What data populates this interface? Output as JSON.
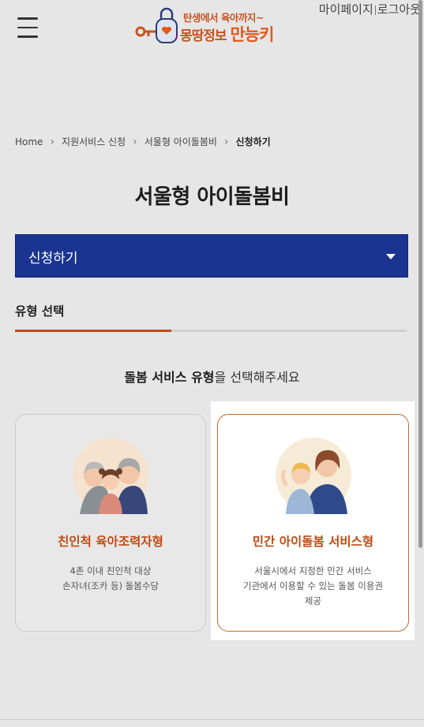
{
  "header": {
    "logo_top": "탄생에서 육아까지~",
    "logo_bottom_prefix": "몽땅정보 ",
    "logo_bottom_emphasis": "만능키",
    "mypage": "마이페이지",
    "logout": "로그아웃"
  },
  "breadcrumb": [
    "Home",
    "지원서비스 신청",
    "서울형 아이돌봄비",
    "신청하기"
  ],
  "page_title": "서울형 아이돌봄비",
  "select": {
    "selected": "신청하기"
  },
  "step": {
    "label": "유형 선택",
    "progress": 0.4
  },
  "prompt": {
    "emphasis": "돌봄 서비스 유형",
    "rest": "을 선택해주세요"
  },
  "cards": [
    {
      "title": "친인척 육아조력자형",
      "desc": [
        "4촌 이내 친인척 대상",
        "손자녀(조카 등) 돌봄수당"
      ],
      "icon": "grandparents-child-illustration"
    },
    {
      "title": "민간 아이돌봄 서비스형",
      "desc": [
        "서울시에서 지정한 민간 서비스",
        "기관에서 이용할 수 있는 돌봄 이용권",
        "제공"
      ],
      "icon": "mother-child-illustration"
    }
  ],
  "colors": {
    "brand_orange": "#c24a12",
    "select_blue": "#1b3490",
    "background": "#e6e6e6"
  }
}
